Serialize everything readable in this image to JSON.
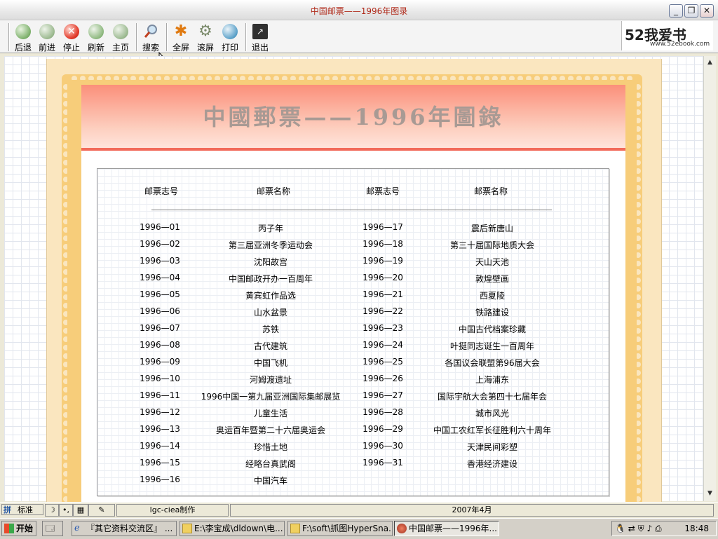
{
  "window": {
    "title": "中国邮票——1996年图录"
  },
  "toolbar": {
    "back": "后退",
    "forward": "前进",
    "stop": "停止",
    "refresh": "刷新",
    "home": "主页",
    "search": "搜索",
    "fullscreen": "全屏",
    "scroll": "滚屏",
    "print": "打印",
    "exit": "退出"
  },
  "logo": {
    "big": "52我爱书",
    "small": "www.52ebook.com"
  },
  "page": {
    "title": "中國郵票——1996年圖錄",
    "headers": {
      "num1": "邮票志号",
      "name1": "邮票名称",
      "num2": "邮票志号",
      "name2": "邮票名称"
    },
    "left": [
      {
        "num": "1996—01",
        "name": "丙子年"
      },
      {
        "num": "1996—02",
        "name": "第三届亚洲冬季运动会"
      },
      {
        "num": "1996—03",
        "name": "沈阳故宫"
      },
      {
        "num": "1996—04",
        "name": "中国邮政开办一百周年"
      },
      {
        "num": "1996—05",
        "name": "黄宾虹作品选"
      },
      {
        "num": "1996—06",
        "name": "山水盆景"
      },
      {
        "num": "1996—07",
        "name": "苏铁"
      },
      {
        "num": "1996—08",
        "name": "古代建筑"
      },
      {
        "num": "1996—09",
        "name": "中国飞机"
      },
      {
        "num": "1996—10",
        "name": "河姆渡遗址"
      },
      {
        "num": "1996—11",
        "name": "1996中国一第九届亚洲国际集邮展览"
      },
      {
        "num": "1996—12",
        "name": "儿童生活"
      },
      {
        "num": "1996—13",
        "name": "奥运百年暨第二十六届奥运会"
      },
      {
        "num": "1996—14",
        "name": "珍惜土地"
      },
      {
        "num": "1996—15",
        "name": "经略台真武阁"
      },
      {
        "num": "1996—16",
        "name": "中国汽车"
      }
    ],
    "right": [
      {
        "num": "1996—17",
        "name": "震后新唐山"
      },
      {
        "num": "1996—18",
        "name": "第三十届国际地质大会"
      },
      {
        "num": "1996—19",
        "name": "天山天池"
      },
      {
        "num": "1996—20",
        "name": "敦煌壁画"
      },
      {
        "num": "1996—21",
        "name": "西夏陵"
      },
      {
        "num": "1996—22",
        "name": "铁路建设"
      },
      {
        "num": "1996—23",
        "name": "中国古代档案珍藏"
      },
      {
        "num": "1996—24",
        "name": "叶挺同志诞生一百周年"
      },
      {
        "num": "1996—25",
        "name": "各国议会联盟第96届大会"
      },
      {
        "num": "1996—26",
        "name": "上海浦东"
      },
      {
        "num": "1996—27",
        "name": "国际宇航大会第四十七届年会"
      },
      {
        "num": "1996—28",
        "name": "城市风光"
      },
      {
        "num": "1996—29",
        "name": "中国工农红军长征胜利六十周年"
      },
      {
        "num": "1996—30",
        "name": "天津民间彩塑"
      },
      {
        "num": "1996—31",
        "name": "香港经济建设"
      }
    ]
  },
  "statusbar": {
    "ime": "标准",
    "author": "lgc-ciea制作",
    "date": "2007年4月"
  },
  "taskbar": {
    "start": "开始",
    "tasks": [
      "『其它资料交流区』 ...",
      "E:\\李宝成\\dldown\\电...",
      "F:\\soft\\抓图HyperSna...",
      "中国邮票——1996年..."
    ],
    "clock": "18:48"
  },
  "colors": {
    "header_top": "#fb8f7a",
    "stamp_border": "#f7cd7a",
    "title_text": "#b02a1a"
  }
}
